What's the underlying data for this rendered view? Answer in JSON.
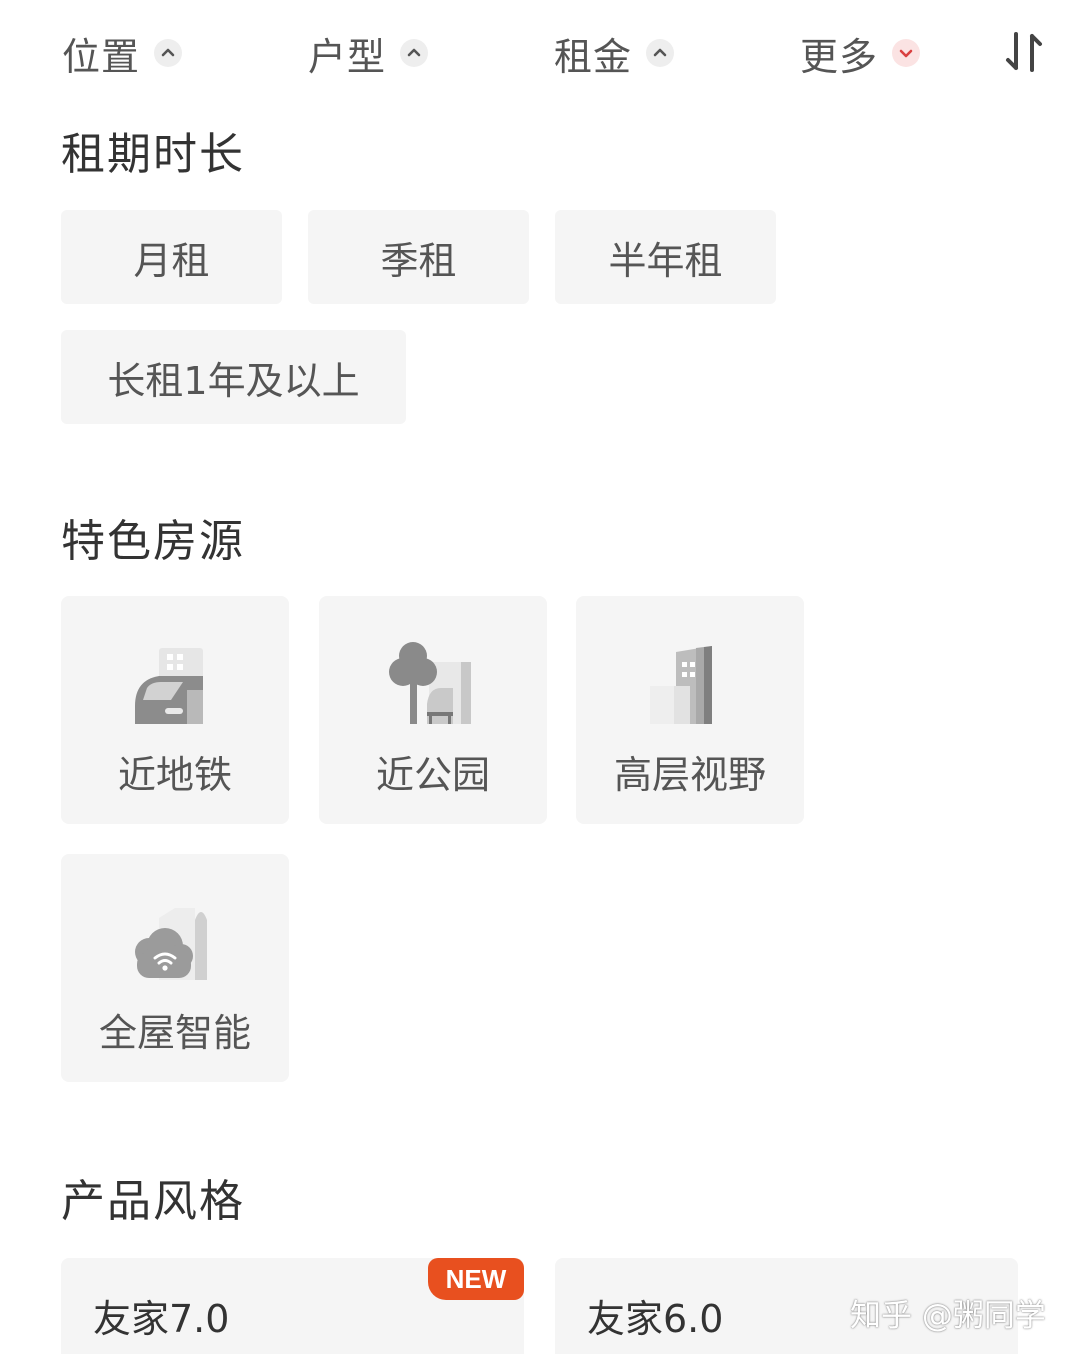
{
  "filter_bar": {
    "tabs": [
      {
        "label": "位置",
        "state": "expanded"
      },
      {
        "label": "户型",
        "state": "expanded"
      },
      {
        "label": "租金",
        "state": "expanded"
      },
      {
        "label": "更多",
        "state": "active"
      }
    ],
    "sort_icon": "sort-arrows-icon"
  },
  "lease_term": {
    "title": "租期时长",
    "options": [
      "月租",
      "季租",
      "半年租",
      "长租1年及以上"
    ]
  },
  "features": {
    "title": "特色房源",
    "items": [
      {
        "label": "近地铁",
        "icon": "subway-icon"
      },
      {
        "label": "近公园",
        "icon": "park-icon"
      },
      {
        "label": "高层视野",
        "icon": "high-rise-icon"
      },
      {
        "label": "全屋智能",
        "icon": "smart-home-icon"
      }
    ]
  },
  "product_style": {
    "title": "产品风格",
    "items": [
      {
        "label": "友家7.0",
        "badge": "NEW"
      },
      {
        "label": "友家6.0",
        "badge": ""
      }
    ]
  },
  "watermark": "知乎 @粥同学",
  "colors": {
    "accent": "#e8501f",
    "chip_bg": "#f5f5f5",
    "active_chevron": "#d94040"
  }
}
